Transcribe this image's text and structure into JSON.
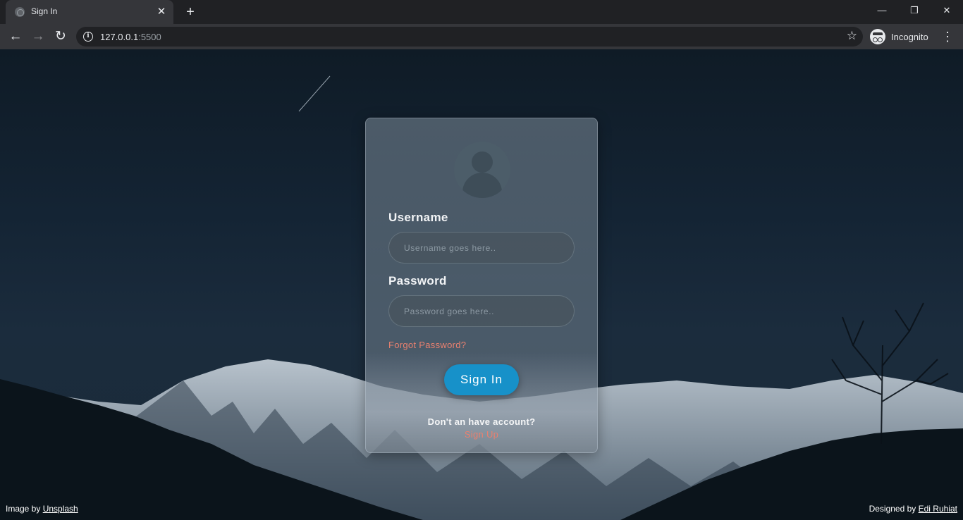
{
  "browser": {
    "tab_title": "Sign In",
    "tab_close": "✕",
    "new_tab": "+",
    "window_controls": {
      "minimize": "—",
      "restore": "❐",
      "close": "✕"
    },
    "nav": {
      "back": "←",
      "forward": "→",
      "reload": "↻"
    },
    "url_host": "127.0.0.1",
    "url_port": ":5500",
    "bookmark_star": "☆",
    "profile_label": "Incognito",
    "menu": "⋮"
  },
  "login": {
    "username_label": "Username",
    "username_placeholder": "Username goes here..",
    "password_label": "Password",
    "password_placeholder": "Password goes here..",
    "forgot_link": "Forgot Password?",
    "signin_button": "Sign In",
    "no_account_text": "Don't an have account?",
    "signup_link": "Sign Up"
  },
  "footer": {
    "left_prefix": "Image by ",
    "left_link": "Unsplash",
    "right_prefix": "Designed by ",
    "right_link": "Edi Ruhiat"
  },
  "colors": {
    "accent_button": "#1791c9",
    "link_salmon": "#e9806f",
    "chrome_dark": "#202124",
    "chrome_toolbar": "#35363a"
  },
  "icons": [
    "globe-icon",
    "close-icon",
    "plus-icon",
    "minimize-icon",
    "restore-icon",
    "back-icon",
    "forward-icon",
    "reload-icon",
    "info-icon",
    "star-icon",
    "incognito-icon",
    "kebab-menu-icon",
    "user-avatar-icon"
  ]
}
